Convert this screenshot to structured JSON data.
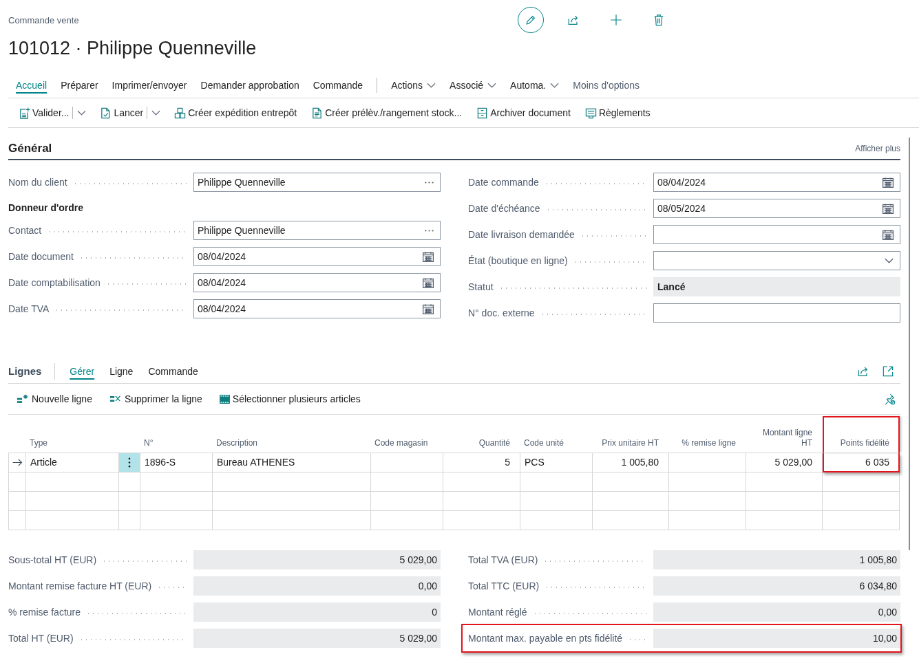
{
  "page": {
    "caption": "Commande vente",
    "title": "101012 · Philippe Quenneville"
  },
  "page_actions": [
    {
      "kind": "edit",
      "on": true
    },
    {
      "kind": "share",
      "on": false
    },
    {
      "kind": "new",
      "on": false
    },
    {
      "kind": "delete",
      "on": false
    }
  ],
  "menu": {
    "tabs": [
      {
        "label": "Accueil",
        "selected": true
      },
      {
        "label": "Préparer",
        "selected": false
      },
      {
        "label": "Imprimer/envoyer",
        "selected": false
      },
      {
        "label": "Demander approbation",
        "selected": false
      },
      {
        "label": "Commande",
        "selected": false
      }
    ],
    "groups": [
      {
        "label": "Actions"
      },
      {
        "label": "Associé"
      },
      {
        "label": "Automa."
      }
    ],
    "less_options": "Moins d'options"
  },
  "action_bar": [
    {
      "label": "Valider...",
      "split": true
    },
    {
      "label": "Lancer",
      "split": true
    },
    {
      "label": "Créer expédition entrepôt",
      "split": false
    },
    {
      "label": "Créer prélèv./rangement stock...",
      "split": false
    },
    {
      "label": "Archiver document",
      "split": false
    },
    {
      "label": "Règlements",
      "split": false
    }
  ],
  "general": {
    "title": "Général",
    "show_more": "Afficher plus",
    "left": [
      {
        "kind": "lookup",
        "label": "Nom du client",
        "value": "Philippe Quenneville"
      },
      {
        "kind": "heading",
        "label": "Donneur d'ordre"
      },
      {
        "kind": "lookup",
        "label": "Contact",
        "value": "Philippe Quenneville"
      },
      {
        "kind": "date",
        "label": "Date document",
        "value": "08/04/2024"
      },
      {
        "kind": "date",
        "label": "Date comptabilisation",
        "value": "08/04/2024"
      },
      {
        "kind": "date",
        "label": "Date TVA",
        "value": "08/04/2024"
      }
    ],
    "right": [
      {
        "kind": "date",
        "label": "Date commande",
        "value": "08/04/2024"
      },
      {
        "kind": "date",
        "label": "Date d'échéance",
        "value": "08/05/2024"
      },
      {
        "kind": "date",
        "label": "Date livraison demandée"
      },
      {
        "kind": "select",
        "label": "État (boutique en ligne)"
      },
      {
        "kind": "readonly",
        "label": "Statut",
        "value": "Lancé"
      },
      {
        "kind": "text",
        "label": "N° doc. externe"
      }
    ]
  },
  "lines": {
    "title": "Lignes",
    "tabs": [
      {
        "label": "Gérer",
        "selected": true
      },
      {
        "label": "Ligne",
        "selected": false
      },
      {
        "label": "Commande",
        "selected": false
      }
    ],
    "actions": [
      {
        "label": "Nouvelle ligne"
      },
      {
        "label": "Supprimer la ligne"
      },
      {
        "label": "Sélectionner plusieurs articles"
      }
    ],
    "table": {
      "columns": [
        {
          "kind": "text",
          "label": "Type",
          "highlighted": false
        },
        {
          "kind": "text",
          "label": "N°",
          "highlighted": false
        },
        {
          "kind": "text",
          "label": "Description",
          "highlighted": false
        },
        {
          "kind": "text",
          "label": "Code magasin",
          "highlighted": false
        },
        {
          "kind": "number",
          "label": "Quantité",
          "highlighted": false
        },
        {
          "kind": "text",
          "label": "Code unité",
          "highlighted": false
        },
        {
          "kind": "number",
          "label": "Prix unitaire HT",
          "highlighted": false
        },
        {
          "kind": "number",
          "label": "% remise ligne",
          "highlighted": false
        },
        {
          "kind": "number",
          "label": "Montant ligne HT",
          "highlighted": false
        },
        {
          "kind": "number",
          "label": "Points fidélité",
          "highlighted": true
        }
      ],
      "rows": [
        {
          "selected": true,
          "cells": [
            "Article",
            "1896-S",
            "Bureau ATHENES",
            null,
            "5",
            "PCS",
            "1 005,80",
            null,
            "5 029,00",
            "6 035"
          ]
        },
        {
          "selected": false
        },
        {
          "selected": false
        },
        {
          "selected": false
        }
      ]
    }
  },
  "totals": {
    "left": [
      {
        "label": "Sous-total HT (EUR)",
        "value": "5 029,00",
        "highlighted": false
      },
      {
        "label": "Montant remise facture HT (EUR)",
        "value": "0,00",
        "highlighted": false
      },
      {
        "label": "% remise facture",
        "value": "0",
        "highlighted": false
      },
      {
        "label": "Total HT (EUR)",
        "value": "5 029,00",
        "highlighted": false
      }
    ],
    "right": [
      {
        "label": "Total TVA (EUR)",
        "value": "1 005,80",
        "highlighted": false
      },
      {
        "label": "Total TTC (EUR)",
        "value": "6 034,80",
        "highlighted": false
      },
      {
        "label": "Montant réglé",
        "value": "0,00",
        "highlighted": false
      },
      {
        "label": "Montant max. payable en pts fidélité",
        "value": "10,00",
        "highlighted": true
      }
    ]
  }
}
